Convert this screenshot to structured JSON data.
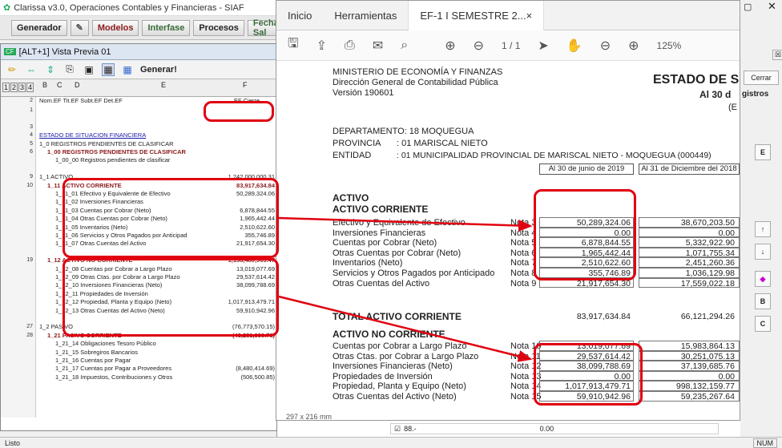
{
  "app": {
    "title": "Clarissa v3.0, Operaciones Contables y Financieras - SIAF",
    "menu": [
      "Generador",
      "Modelos",
      "Interfase",
      "Procesos",
      "Fecha Sal"
    ],
    "subwindow_title": "[ALT+1] Vista Previa 01",
    "generate_label": "Generar!",
    "levels": [
      "1",
      "2",
      "3",
      "4"
    ],
    "col_letters": [
      "B",
      "C",
      "D",
      "E",
      "F"
    ],
    "header_row": {
      "num": "2",
      "text": "Nom.EF  Tit.EF  Subt.EF  Det.EF",
      "value": "EF Cierre"
    },
    "rows": [
      {
        "n": "1",
        "t": "",
        "v": "",
        "ind": 0
      },
      {
        "n": "",
        "t": "",
        "v": "",
        "ind": 0
      },
      {
        "n": "3",
        "t": "",
        "v": "",
        "ind": 0
      },
      {
        "n": "4",
        "t": "ESTADO DE SITUACION FINANCIERA",
        "v": "",
        "ind": 0,
        "style": "link"
      },
      {
        "n": "5",
        "t": "1_0   REGISTROS PENDIENTES DE CLASIFICAR",
        "v": "",
        "ind": 0
      },
      {
        "n": "6",
        "t": "1_00  REGISTROS PENDIENTES DE CLASIFICAR",
        "v": "",
        "ind": 1,
        "style": "redbold"
      },
      {
        "n": "",
        "t": "1_00_00  Registros pendientes de clasificar",
        "v": "",
        "ind": 2
      },
      {
        "n": "",
        "t": "",
        "v": "",
        "ind": 0
      },
      {
        "n": "9",
        "t": "1_1   ACTIVO",
        "v": "1,242,000,000.31",
        "ind": 0
      },
      {
        "n": "10",
        "t": "1_11  ACTIVO CORRIENTE",
        "v": "83,917,634.84",
        "ind": 1,
        "style": "redbold"
      },
      {
        "n": "",
        "t": "1_11_01  Efectivo y Equivalente de Efectivo",
        "v": "50,289,324.06",
        "ind": 2
      },
      {
        "n": "",
        "t": "1_11_02  Inversiones Financieras",
        "v": "",
        "ind": 2
      },
      {
        "n": "",
        "t": "1_11_03  Cuentas por Cobrar (Neto)",
        "v": "6,878,844.55",
        "ind": 2
      },
      {
        "n": "",
        "t": "1_11_04  Otras Cuentas por Cobrar (Neto)",
        "v": "1,965,442.44",
        "ind": 2
      },
      {
        "n": "",
        "t": "1_11_05  Inventarios (Neto)",
        "v": "2,510,622.60",
        "ind": 2
      },
      {
        "n": "",
        "t": "1_11_06  Servicios y Otros Pagados por Anticipad",
        "v": "355,746.89",
        "ind": 2
      },
      {
        "n": "",
        "t": "1_11_07  Otras Cuentas del Activo",
        "v": "21,917,654.30",
        "ind": 2
      },
      {
        "n": "",
        "t": "",
        "v": "",
        "ind": 0
      },
      {
        "n": "19",
        "t": "1_12  ACTIVO NO CORRIENTE",
        "v": "1,158,480,903.47",
        "ind": 1,
        "style": "redbold"
      },
      {
        "n": "",
        "t": "1_12_08  Cuentas por Cobrar a Largo Plazo",
        "v": "13,019,077.69",
        "ind": 2
      },
      {
        "n": "",
        "t": "1_12_09  Otras Ctas. por Cobrar a Largo Plazo",
        "v": "29,537,614.42",
        "ind": 2
      },
      {
        "n": "",
        "t": "1_12_10  Inversiones Financieras (Neto)",
        "v": "38,099,788.69",
        "ind": 2
      },
      {
        "n": "",
        "t": "1_12_11  Propiedades de Inversión",
        "v": "",
        "ind": 2
      },
      {
        "n": "",
        "t": "1_12_12  Propiedad, Planta y Equipo (Neto)",
        "v": "1,017,913,479.71",
        "ind": 2
      },
      {
        "n": "",
        "t": "1_12_13  Otras Cuentas del Activo (Neto)",
        "v": "59,910,942.96",
        "ind": 2
      },
      {
        "n": "",
        "t": "",
        "v": "",
        "ind": 0
      },
      {
        "n": "27",
        "t": "1_2   PASIVO",
        "v": "(76,773,570.15)",
        "ind": 0
      },
      {
        "n": "28",
        "t": "1_21  PASIVO CORRIENTE",
        "v": "(43,281,890.78)",
        "ind": 1,
        "style": "redbold"
      },
      {
        "n": "",
        "t": "1_21_14  Obligaciones Tesoro Público",
        "v": "",
        "ind": 2
      },
      {
        "n": "",
        "t": "1_21_15  Sobregiros Bancarios",
        "v": "",
        "ind": 2
      },
      {
        "n": "",
        "t": "1_21_16  Cuentas por Pagar",
        "v": "",
        "ind": 2
      },
      {
        "n": "",
        "t": "1_21_17  Cuentas por Pagar a Proveedores",
        "v": "(8,480,414.69)",
        "ind": 2
      },
      {
        "n": "",
        "t": "1_21_18  Impuestos, Contribuciones y Otros",
        "v": "(506,500.85)",
        "ind": 2
      }
    ],
    "status_left": "Listo",
    "status_right": "NUM"
  },
  "viewer": {
    "tabs": [
      "Inicio",
      "Herramientas",
      "EF-1 I SEMESTRE 2..."
    ],
    "page_indicator": "1 / 1",
    "zoom": "125%",
    "page_size": "297 x 216 mm",
    "doc": {
      "ministry": "MINISTERIO DE ECONOMÍA Y FINANZAS",
      "direction": "Dirección General de Contabilidad Pública",
      "version": "Versión 190601",
      "title": "ESTADO DE SIT",
      "subtitle": "Al 30 d",
      "subtitle2": "(E",
      "departamento": "DEPARTAMENTO: 18 MOQUEGUA",
      "provincia_label": "PROVINCIA",
      "provincia": ": 01 MARISCAL NIETO",
      "entidad_label": "ENTIDAD",
      "entidad": ": 01 MUNICIPALIDAD PROVINCIAL DE MARISCAL NIETO - MOQUEGUA (000449)",
      "col1": "Al 30 de junio de 2019",
      "col2": "Al 31 de Diciembre del 2018",
      "activo": "ACTIVO",
      "activo_corriente": "ACTIVO CORRIENTE",
      "current": [
        {
          "label": "Efectivo y Equivalente de Efectivo",
          "nota": "Nota 3",
          "v1": "50,289,324.06",
          "v2": "38,670,203.50"
        },
        {
          "label": "Inversiones Financieras",
          "nota": "Nota 4",
          "v1": "0.00",
          "v2": "0.00"
        },
        {
          "label": "Cuentas por Cobrar (Neto)",
          "nota": "Nota 5",
          "v1": "6,878,844.55",
          "v2": "5,332,922.90"
        },
        {
          "label": "Otras Cuentas por Cobrar (Neto)",
          "nota": "Nota 6",
          "v1": "1,965,442.44",
          "v2": "1,071,755.34"
        },
        {
          "label": "Inventarios (Neto)",
          "nota": "Nota 7",
          "v1": "2,510,622.60",
          "v2": "2,451,260.36"
        },
        {
          "label": "Servicios y Otros Pagados por Anticipado",
          "nota": "Nota 8",
          "v1": "355,746.89",
          "v2": "1,036,129.98"
        },
        {
          "label": "Otras Cuentas del Activo",
          "nota": "Nota 9",
          "v1": "21,917,654.30",
          "v2": "17,559,022.18"
        }
      ],
      "total_corriente_label": "TOTAL ACTIVO CORRIENTE",
      "total_corriente_v1": "83,917,634.84",
      "total_corriente_v2": "66,121,294.26",
      "activo_no_corriente": "ACTIVO NO CORRIENTE",
      "noncurrent": [
        {
          "label": "Cuentas por Cobrar a Largo Plazo",
          "nota": "Nota 10",
          "v1": "13,019,077.69",
          "v2": "15,983,864.13"
        },
        {
          "label": "Otras Ctas. por Cobrar a Largo Plazo",
          "nota": "Nota 11",
          "v1": "29,537,614.42",
          "v2": "30,251,075.13"
        },
        {
          "label": "Inversiones Financieras (Neto)",
          "nota": "Nota 12",
          "v1": "38,099,788.69",
          "v2": "37,139,685.76"
        },
        {
          "label": "Propiedades de Inversión",
          "nota": "Nota 13",
          "v1": "0.00",
          "v2": "0.00"
        },
        {
          "label": "Propiedad, Planta y Equipo (Neto)",
          "nota": "Nota 14",
          "v1": "1,017,913,479.71",
          "v2": "998,132,159.77"
        },
        {
          "label": "Otras Cuentas del Activo (Neto)",
          "nota": "Nota 15",
          "v1": "59,910,942.96",
          "v2": "59,235,267.64"
        }
      ]
    }
  },
  "right_panel": {
    "cerrar": "Cerrar",
    "registros": "gistros",
    "buttons": [
      "E",
      "↑",
      "↓",
      "B",
      "C"
    ],
    "grid_item": "88.-",
    "grid_value": "0.00"
  },
  "colors": {
    "highlight": "#e00010",
    "link": "#1a1aa8",
    "dark_red": "#8b1a1a"
  }
}
